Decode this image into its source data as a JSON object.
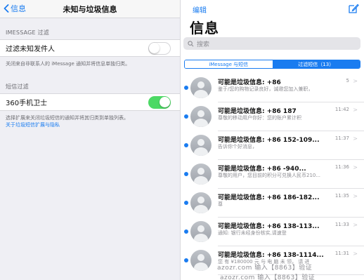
{
  "left": {
    "back_label": "信息",
    "title": "未知与垃圾信息",
    "imessage_section_header": "IMESSAGE 过滤",
    "filter_unknown_label": "过滤未知发件人",
    "filter_unknown_on": false,
    "filter_unknown_footer": "关闭来自非联系人的 iMessage 通知并将信息单独归类。",
    "sms_section_header": "短信过滤",
    "filter_app_label": "360手机卫士",
    "filter_app_on": true,
    "sms_footer": "选择扩展来关闭垃圾短信的通知并将其归类到单独列表。",
    "sms_footer_link": "关于垃圾短信扩展与隐私"
  },
  "right": {
    "edit_label": "编辑",
    "title": "信息",
    "search_placeholder": "搜索",
    "segments": [
      {
        "label": "iMessage 与短信",
        "active": false
      },
      {
        "label": "过滤短信（13）",
        "active": true
      }
    ],
    "messages": [
      {
        "sender": "可能是垃圾信息: +86",
        "time": "5",
        "preview": "鉴于/您的购物记录良好，诚邀您加入兼职，"
      },
      {
        "sender": "可能是垃圾信息: +86 187",
        "time": "11:42",
        "preview": "尊敬的移动用户你好：您的账户累计积"
      },
      {
        "sender": "可能是垃圾信息: +86 152-109...",
        "time": "11:37",
        "preview": "告诉你个好消息，"
      },
      {
        "sender": "可能是垃圾信息: +86 -940...",
        "time": "11:36",
        "preview": "尊敬的用户，您目前的积分可兑换人民币210..."
      },
      {
        "sender": "可能是垃圾信息: +86 186-182...",
        "time": "11:35",
        "preview": "尊"
      },
      {
        "sender": "可能是垃圾信息: +86 138-113...",
        "time": "11:33",
        "preview": "通知: 银行未经身份核实,请速登"
      },
      {
        "sender": "可能是垃圾信息: +86 138-1114...",
        "time": "11:31",
        "preview": "您 有 ¥180000 元 与 电 脑 未 领， 请 进"
      }
    ],
    "watermark": "azozr.com 输入【8863】验证",
    "watermark2": "azozr.com 输入【8863】验证"
  },
  "colors": {
    "accent": "#1a7cf0",
    "toggle_on": "#4cd964",
    "grouped_bg": "#efeff4"
  }
}
